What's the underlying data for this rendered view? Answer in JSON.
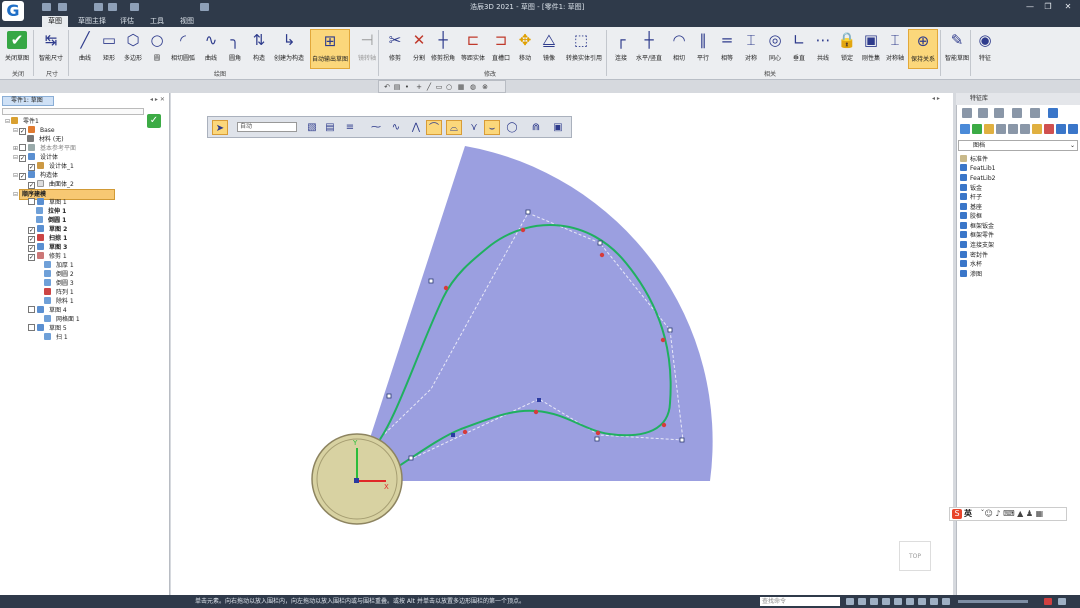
{
  "app": {
    "logo": "G",
    "title": "浩辰3D 2021 - 草图 - [零件1: 草图]",
    "window_buttons": [
      "—",
      "❐",
      "✕"
    ]
  },
  "tabs": [
    {
      "label": "草图",
      "active": true
    },
    {
      "label": "草图主择",
      "active": false
    },
    {
      "label": "评估",
      "active": false
    },
    {
      "label": "工具",
      "active": false
    },
    {
      "label": "视图",
      "active": false
    }
  ],
  "ribbon": {
    "buttons": [
      {
        "label": "关闭草图",
        "icon": "✔"
      },
      {
        "label": "智能尺寸",
        "icon": "↹"
      },
      {
        "label": "曲线",
        "icon": "╱"
      },
      {
        "label": "矩形",
        "icon": "▭"
      },
      {
        "label": "多边形",
        "icon": "⬡"
      },
      {
        "label": "圆",
        "icon": "○"
      },
      {
        "label": "相切圆弧",
        "icon": "◜"
      },
      {
        "label": "曲线",
        "icon": "∿"
      },
      {
        "label": "圆角",
        "icon": "╮"
      },
      {
        "label": "构造",
        "icon": "⇅"
      },
      {
        "label": "创建为构造",
        "icon": "↳"
      },
      {
        "label": "自动输出草图",
        "icon": "⊞"
      },
      {
        "label": "镜转轴",
        "icon": "⊣"
      },
      {
        "label": "修剪",
        "icon": "✂"
      },
      {
        "label": "分割",
        "icon": "✕"
      },
      {
        "label": "修剪拐角",
        "icon": "┼"
      },
      {
        "label": "等距实体",
        "icon": "⊏"
      },
      {
        "label": "直槽口",
        "icon": "⊐"
      },
      {
        "label": "移动",
        "icon": "✥"
      },
      {
        "label": "镜像",
        "icon": "⧋"
      },
      {
        "label": "转换实体引用",
        "icon": "⬚"
      },
      {
        "label": "连接",
        "icon": "┌"
      },
      {
        "label": "水平/竖直",
        "icon": "┼"
      },
      {
        "label": "相切",
        "icon": "◠"
      },
      {
        "label": "平行",
        "icon": "∥"
      },
      {
        "label": "相等",
        "icon": "="
      },
      {
        "label": "对称",
        "icon": "⌶"
      },
      {
        "label": "同心",
        "icon": "◎"
      },
      {
        "label": "垂直",
        "icon": "∟"
      },
      {
        "label": "共线",
        "icon": "⋯"
      },
      {
        "label": "锁定",
        "icon": "🔒"
      },
      {
        "label": "刚性集",
        "icon": "▣"
      },
      {
        "label": "对称轴",
        "icon": "⌶"
      },
      {
        "label": "保持关系",
        "icon": "⊕"
      },
      {
        "label": "智能草图",
        "icon": "✎"
      },
      {
        "label": "特征",
        "icon": "◉"
      }
    ],
    "groups": [
      "关闭",
      "尺寸",
      "绘图",
      "修改",
      "相关"
    ]
  },
  "tree": {
    "tab_label": "零件1: 草图",
    "rows": [
      {
        "label": "零件1"
      },
      {
        "label": "Base"
      },
      {
        "label": "材料 (无)"
      },
      {
        "label": "基本参考平面"
      },
      {
        "label": "设计体"
      },
      {
        "label": "设计体_1"
      },
      {
        "label": "构造体"
      },
      {
        "label": "曲面体_2"
      },
      {
        "label": "顺序建模"
      },
      {
        "label": "草图 1"
      },
      {
        "label": "拉伸 1"
      },
      {
        "label": "倒圆 1"
      },
      {
        "label": "草图 2"
      },
      {
        "label": "扫掠 1"
      },
      {
        "label": "草图 3"
      },
      {
        "label": "修剪 1"
      },
      {
        "label": "加厚 1"
      },
      {
        "label": "倒圆 2"
      },
      {
        "label": "倒圆 3"
      },
      {
        "label": "阵列 1"
      },
      {
        "label": "除料 1"
      },
      {
        "label": "草图 4"
      },
      {
        "label": "网格面 1"
      },
      {
        "label": "草图 5"
      },
      {
        "label": "扫 1"
      }
    ]
  },
  "sketch_toolbar": {
    "select_value": "自动"
  },
  "orient_cube": "TOP",
  "feature_library": {
    "title": "特征库",
    "dropdown": "图档",
    "items": [
      "标准件",
      "FeatLib1",
      "FeatLib2",
      "钣金",
      "杆子",
      "基座",
      "胶框",
      "框架钣金",
      "框架零件",
      "连接支架",
      "密封件",
      "水杯",
      "渗图"
    ]
  },
  "ime": {
    "label": "英"
  },
  "statusbar": {
    "message": "单击元素。向右拖动以放入围栏内，向左拖动以放入围栏内或与围栏重叠。或按 Alt 并单击以放置多边形围栏的第一个顶点。",
    "search_placeholder": "查找命令"
  },
  "colors": {
    "accent": "#fbd77b",
    "title_bg": "#2f3a4a",
    "sector": "#9b9fe0",
    "spline": "#20b060"
  }
}
